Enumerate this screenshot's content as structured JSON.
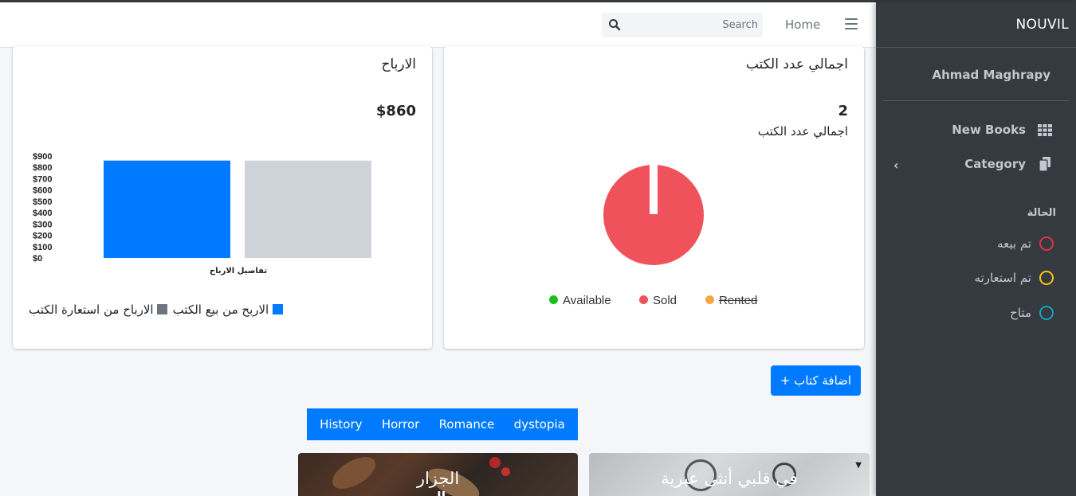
{
  "navbar": {
    "search_placeholder": "Search",
    "home_label": "Home",
    "icons": {
      "search": "search-icon",
      "menu": "hamburger-icon"
    }
  },
  "sidebar": {
    "brand": "NOUVIL",
    "user_name": "Ahmad Maghrapy",
    "items": [
      {
        "label": "New Books",
        "icon": "grid-icon"
      },
      {
        "label": "Category",
        "icon": "copy-icon",
        "chevron": "‹"
      }
    ],
    "status_header": "الحالة",
    "status_items": [
      {
        "label": "تم بيعه",
        "color": "#dc3545"
      },
      {
        "label": "تم استعارته",
        "color": "#ffc107"
      },
      {
        "label": "متاح",
        "color": "#17a2b8"
      }
    ]
  },
  "profit_card": {
    "title": "الارباح",
    "total": "$860",
    "legend": [
      {
        "label": "الاربح من بيع الكتب",
        "color": "#007bff"
      },
      {
        "label": "الارباح من استعارة الكتب",
        "color": "#6c757d"
      }
    ]
  },
  "books_card": {
    "title": "اجمالي عدد الكتب",
    "count": "2",
    "count_label": "اجمالي عدد الكتب",
    "legend": [
      {
        "label": "Available",
        "color": "#1bbf1b",
        "struck": false
      },
      {
        "label": "Sold",
        "color": "#f0525c",
        "struck": false
      },
      {
        "label": "Rented",
        "color": "#f5a742",
        "struck": true
      }
    ]
  },
  "chart_data": [
    {
      "type": "bar",
      "categories": [
        "تفاصيل الارباح"
      ],
      "xlabel": "تفاصيل الارباح",
      "series": [
        {
          "name": "الاربح من بيع الكتب",
          "values": [
            860
          ],
          "color": "#007bff"
        },
        {
          "name": "الارباح من استعارة الكتب",
          "values": [
            860
          ],
          "color": "#ced3da"
        }
      ],
      "yticks": [
        "$0",
        "$100",
        "$200",
        "$300",
        "$400",
        "$500",
        "$600",
        "$700",
        "$800",
        "$900"
      ],
      "ylim": [
        0,
        900
      ]
    },
    {
      "type": "pie",
      "labels": [
        "Available",
        "Sold",
        "Rented"
      ],
      "values": [
        0,
        2,
        0
      ],
      "colors": [
        "#1bbf1b",
        "#f0525c",
        "#f5a742"
      ]
    }
  ],
  "add_button": "+ اضافة كتاب",
  "tabs": [
    "History",
    "Horror",
    "Romance",
    "dystopia"
  ],
  "books": [
    {
      "title": "الجزار",
      "subtitle": "ال"
    },
    {
      "title": "في قلبي أنثى عبرية",
      "subtitle": ""
    }
  ]
}
